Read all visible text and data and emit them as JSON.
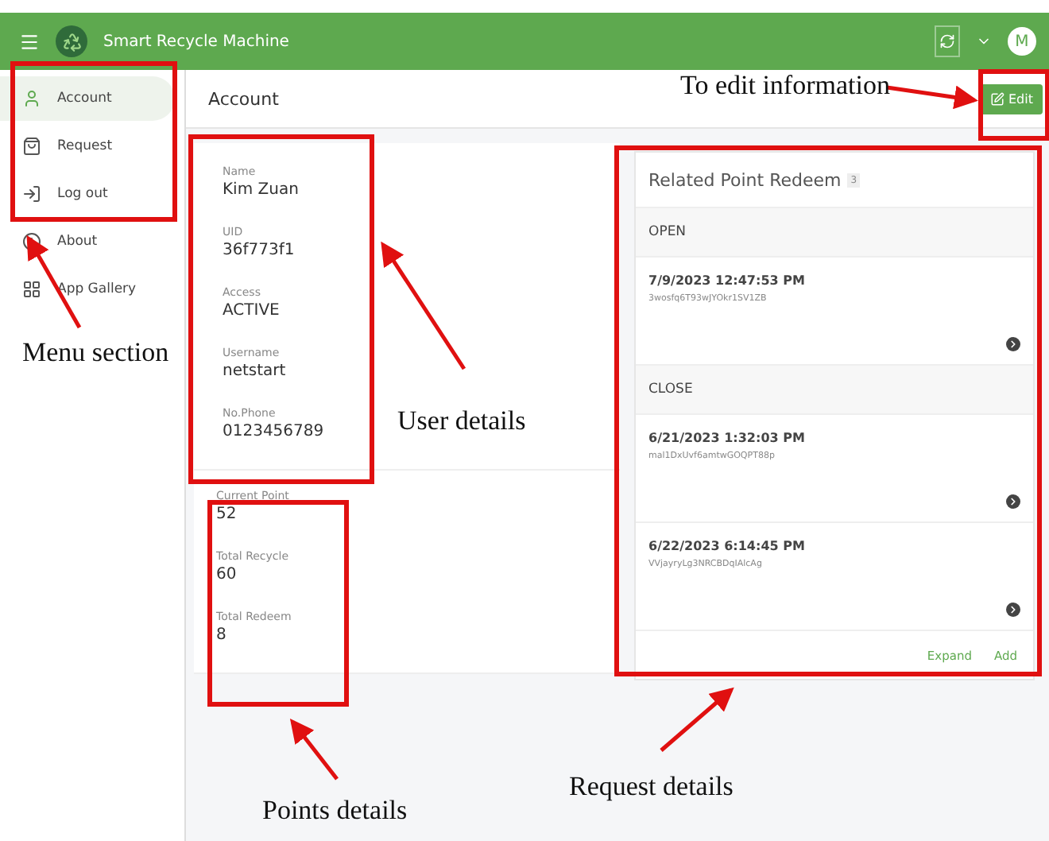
{
  "app_bar": {
    "title": "Smart Recycle Machine",
    "avatar": "M"
  },
  "sidebar": {
    "items": [
      {
        "label": "Account",
        "selected": true
      },
      {
        "label": "Request",
        "selected": false
      },
      {
        "label": "Log out",
        "selected": false
      },
      {
        "label": "About",
        "selected": false
      },
      {
        "label": "App Gallery",
        "selected": false
      }
    ]
  },
  "page_header": {
    "title": "Account",
    "edit_button": "Edit"
  },
  "user_details": [
    {
      "label": "Name",
      "value": "Kim Zuan"
    },
    {
      "label": "UID",
      "value": "36f773f1"
    },
    {
      "label": "Access",
      "value": "ACTIVE"
    },
    {
      "label": "Username",
      "value": "netstart"
    },
    {
      "label": "No.Phone",
      "value": "0123456789"
    }
  ],
  "points_details": [
    {
      "label": "Current Point",
      "value": "52"
    },
    {
      "label": "Total Recycle",
      "value": "60"
    },
    {
      "label": "Total Redeem",
      "value": "8"
    }
  ],
  "related": {
    "title": "Related Point Redeem",
    "count": "3",
    "groups": [
      {
        "heading": "OPEN",
        "items": [
          {
            "date": "7/9/2023 12:47:53 PM",
            "id": "3wosfq6T93wJYOkr1SV1ZB"
          }
        ]
      },
      {
        "heading": "CLOSE",
        "items": [
          {
            "date": "6/21/2023 1:32:03 PM",
            "id": "mal1DxUvf6amtwGOQPT88p"
          },
          {
            "date": "6/22/2023 6:14:45 PM",
            "id": "VVjayryLg3NRCBDqIAlcAg"
          }
        ]
      }
    ],
    "actions": [
      "Expand",
      "Add"
    ]
  },
  "annotations": [
    {
      "text": "To edit information"
    },
    {
      "text": "Menu section"
    },
    {
      "text": "User details"
    },
    {
      "text": "Points details"
    },
    {
      "text": "Request details"
    }
  ]
}
